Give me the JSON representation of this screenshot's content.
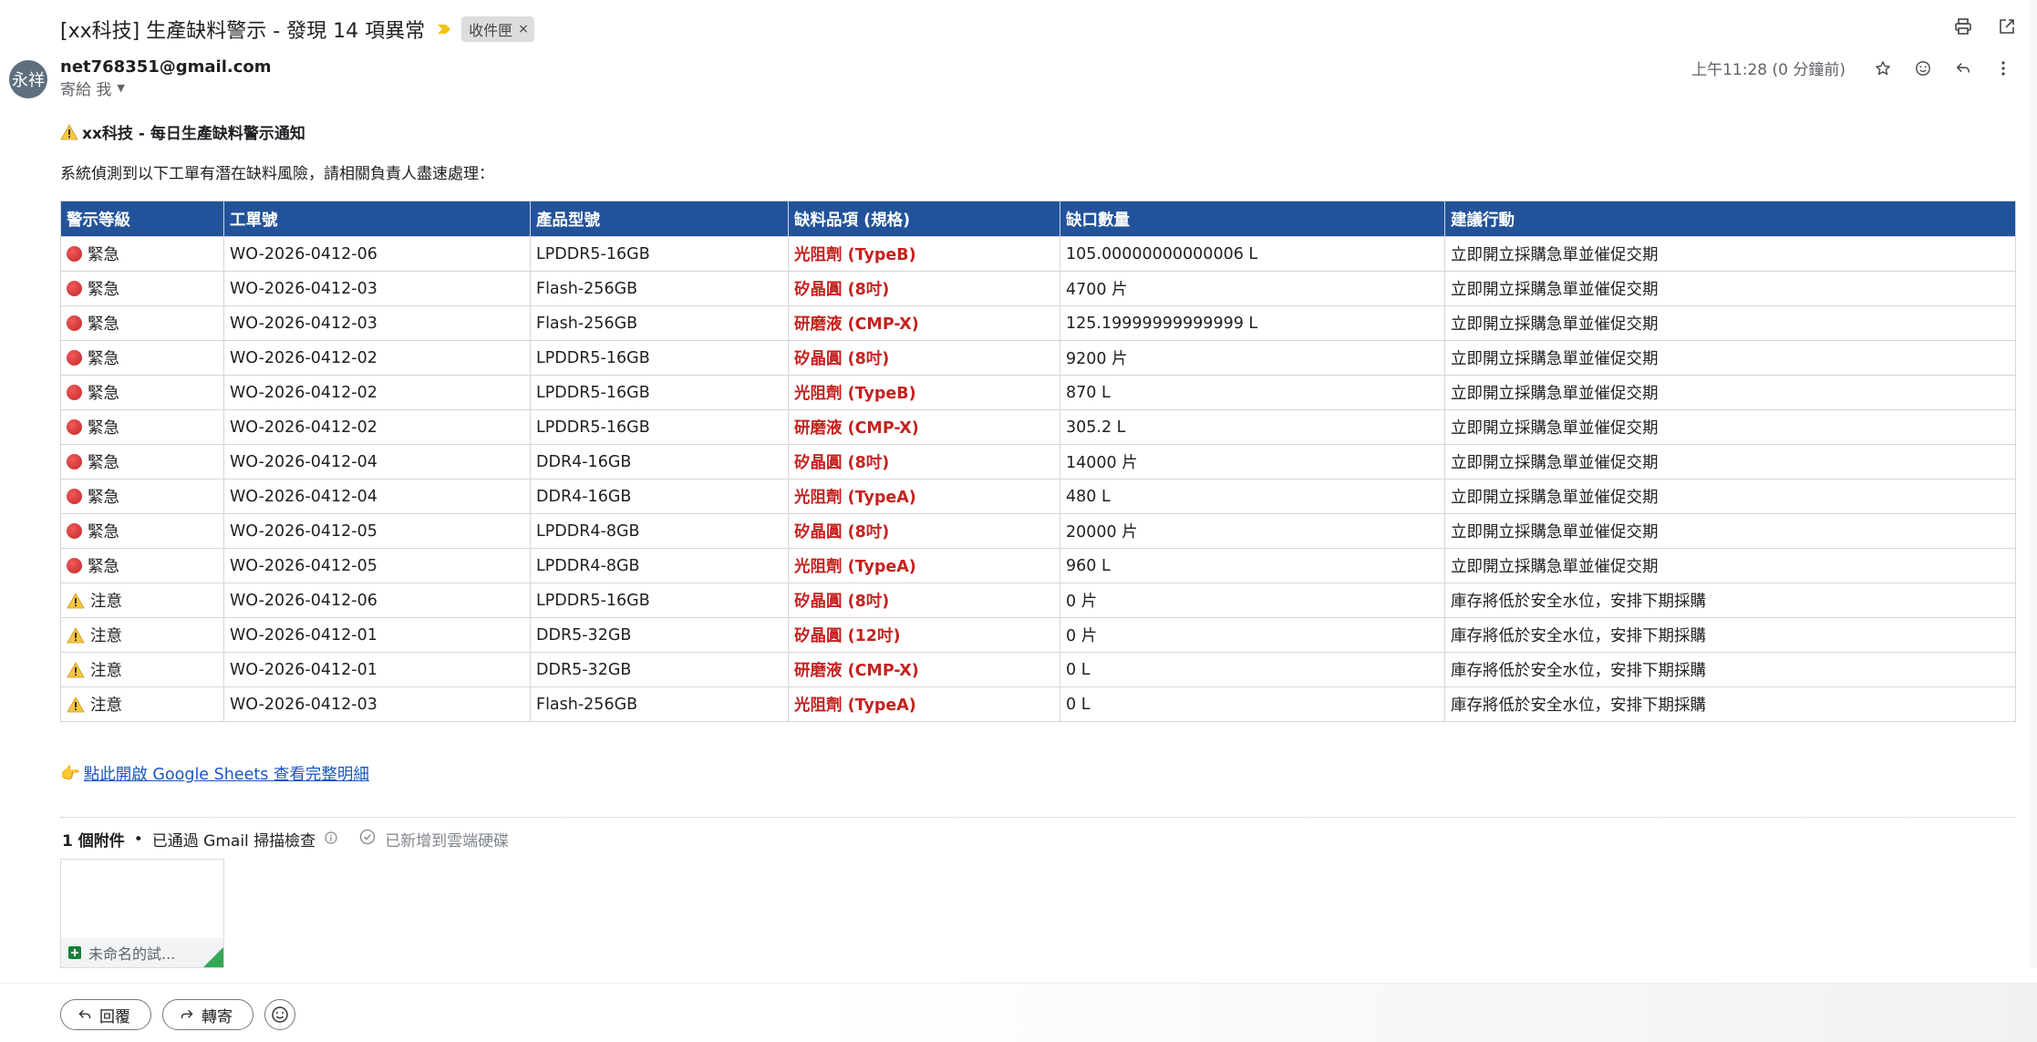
{
  "email": {
    "subject": "[xx科技] 生產缺料警示 - 發現 14 項異常",
    "label": "收件匣",
    "label_close": "×",
    "avatar_text": "永祥",
    "sender_email": "net768351@gmail.com",
    "to_me": "寄給 我",
    "timestamp": "上午11:28 (0 分鐘前)"
  },
  "body": {
    "title": "xx科技 - 每日生產缺料警示通知",
    "intro": "系統偵測到以下工單有潛在缺料風險，請相關負責人盡速處理：",
    "table": {
      "headers": [
        "警示等級",
        "工單號",
        "產品型號",
        "缺料品項 (規格)",
        "缺口數量",
        "建議行動"
      ],
      "rows": [
        {
          "level": "緊急",
          "kind": "urgent",
          "wo": "WO-2026-0412-06",
          "product": "LPDDR5-16GB",
          "item": "光阻劑 (TypeB)",
          "qty": "105.00000000000006 L",
          "action": "立即開立採購急單並催促交期"
        },
        {
          "level": "緊急",
          "kind": "urgent",
          "wo": "WO-2026-0412-03",
          "product": "Flash-256GB",
          "item": "矽晶圓 (8吋)",
          "qty": "4700 片",
          "action": "立即開立採購急單並催促交期"
        },
        {
          "level": "緊急",
          "kind": "urgent",
          "wo": "WO-2026-0412-03",
          "product": "Flash-256GB",
          "item": "研磨液 (CMP-X)",
          "qty": "125.19999999999999 L",
          "action": "立即開立採購急單並催促交期"
        },
        {
          "level": "緊急",
          "kind": "urgent",
          "wo": "WO-2026-0412-02",
          "product": "LPDDR5-16GB",
          "item": "矽晶圓 (8吋)",
          "qty": "9200 片",
          "action": "立即開立採購急單並催促交期"
        },
        {
          "level": "緊急",
          "kind": "urgent",
          "wo": "WO-2026-0412-02",
          "product": "LPDDR5-16GB",
          "item": "光阻劑 (TypeB)",
          "qty": "870 L",
          "action": "立即開立採購急單並催促交期"
        },
        {
          "level": "緊急",
          "kind": "urgent",
          "wo": "WO-2026-0412-02",
          "product": "LPDDR5-16GB",
          "item": "研磨液 (CMP-X)",
          "qty": "305.2 L",
          "action": "立即開立採購急單並催促交期"
        },
        {
          "level": "緊急",
          "kind": "urgent",
          "wo": "WO-2026-0412-04",
          "product": "DDR4-16GB",
          "item": "矽晶圓 (8吋)",
          "qty": "14000 片",
          "action": "立即開立採購急單並催促交期"
        },
        {
          "level": "緊急",
          "kind": "urgent",
          "wo": "WO-2026-0412-04",
          "product": "DDR4-16GB",
          "item": "光阻劑 (TypeA)",
          "qty": "480 L",
          "action": "立即開立採購急單並催促交期"
        },
        {
          "level": "緊急",
          "kind": "urgent",
          "wo": "WO-2026-0412-05",
          "product": "LPDDR4-8GB",
          "item": "矽晶圓 (8吋)",
          "qty": "20000 片",
          "action": "立即開立採購急單並催促交期"
        },
        {
          "level": "緊急",
          "kind": "urgent",
          "wo": "WO-2026-0412-05",
          "product": "LPDDR4-8GB",
          "item": "光阻劑 (TypeA)",
          "qty": "960 L",
          "action": "立即開立採購急單並催促交期"
        },
        {
          "level": "注意",
          "kind": "warning",
          "wo": "WO-2026-0412-06",
          "product": "LPDDR5-16GB",
          "item": "矽晶圓 (8吋)",
          "qty": "0 片",
          "action": "庫存將低於安全水位，安排下期採購"
        },
        {
          "level": "注意",
          "kind": "warning",
          "wo": "WO-2026-0412-01",
          "product": "DDR5-32GB",
          "item": "矽晶圓 (12吋)",
          "qty": "0 片",
          "action": "庫存將低於安全水位，安排下期採購"
        },
        {
          "level": "注意",
          "kind": "warning",
          "wo": "WO-2026-0412-01",
          "product": "DDR5-32GB",
          "item": "研磨液 (CMP-X)",
          "qty": "0 L",
          "action": "庫存將低於安全水位，安排下期採購"
        },
        {
          "level": "注意",
          "kind": "warning",
          "wo": "WO-2026-0412-03",
          "product": "Flash-256GB",
          "item": "光阻劑 (TypeA)",
          "qty": "0 L",
          "action": "庫存將低於安全水位，安排下期採購"
        }
      ]
    },
    "link_emoji": "👉",
    "link_text": "點此開啟 Google Sheets 查看完整明細"
  },
  "attachments": {
    "count_label": "1 個附件",
    "separator": "•",
    "scan_status": "已通過 Gmail 掃描檢查",
    "drive_status": "已新增到雲端硬碟",
    "file_name": "未命名的試..."
  },
  "actions": {
    "reply": "回覆",
    "forward": "轉寄"
  },
  "icons": [
    "important-marker-icon",
    "print-icon",
    "open-in-new-window-icon",
    "star-icon",
    "emoji-icon",
    "reply-icon",
    "more-vert-icon",
    "warning-icon",
    "urgent-red-dot-icon",
    "info-icon",
    "check-circle-icon",
    "sheets-icon",
    "forward-icon"
  ],
  "colors": {
    "table_header": "#22539a",
    "item_text": "#c5221f",
    "link": "#1a56c4",
    "avatar_bg": "#5f6f7e"
  }
}
